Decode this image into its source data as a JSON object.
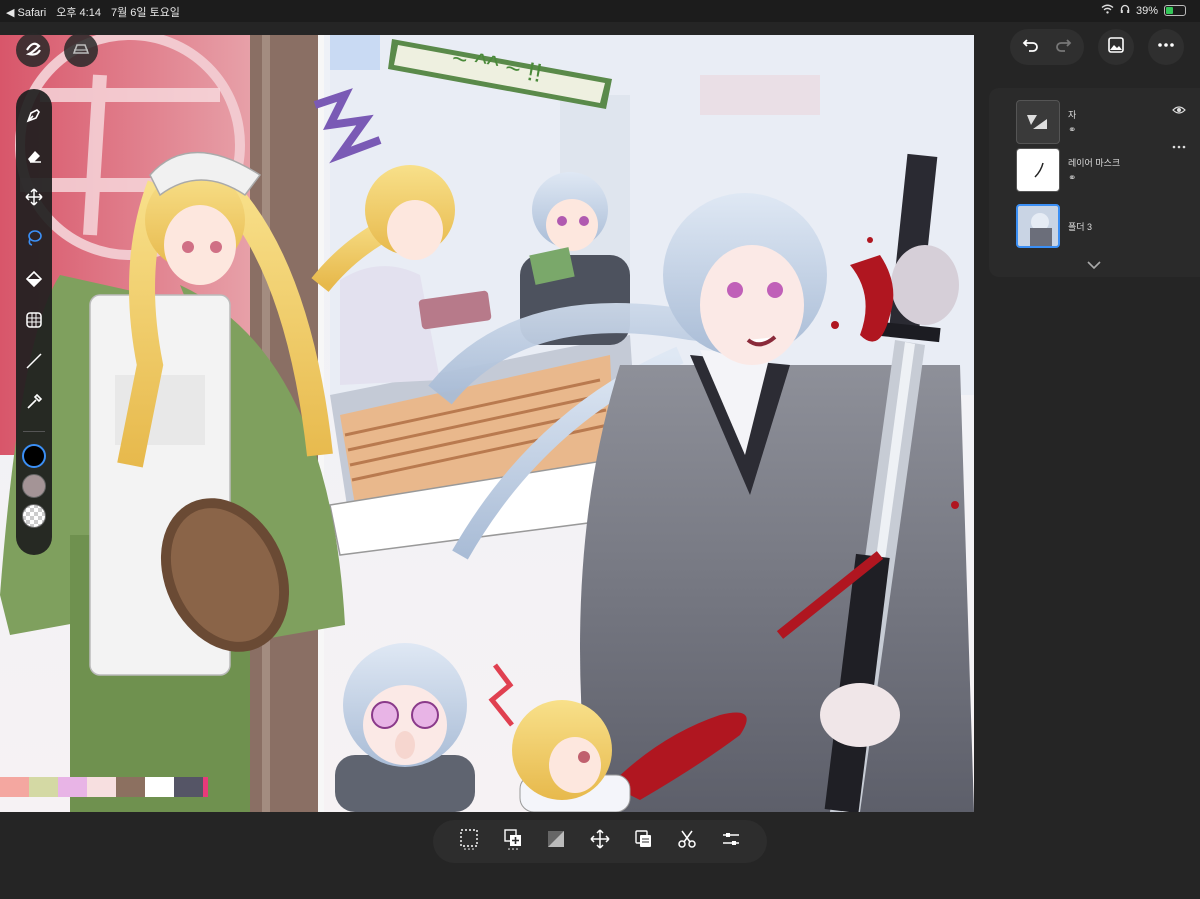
{
  "status_bar": {
    "back_label": "◀ Safari",
    "time": "오후 4:14",
    "date": "7월 6일 토요일",
    "battery": "39%",
    "battery_level": 0.39
  },
  "canvas": {
    "sign_text": "~ ^^ ~ !!"
  },
  "palette": [
    "#f4a7a0",
    "#d4d9a4",
    "#e8b4e6",
    "#f7dfe0",
    "#8c7060",
    "#ffffff",
    "#555566",
    "#e83a7a"
  ],
  "colors": {
    "primary": "#000000",
    "secondary": "#a49496",
    "tertiary": "transparent",
    "accent": "#3b8ff5"
  },
  "toolbar": {
    "tools": [
      {
        "name": "pen-icon"
      },
      {
        "name": "eraser-icon"
      },
      {
        "name": "move-icon"
      },
      {
        "name": "lasso-icon",
        "active": true
      },
      {
        "name": "fill-icon"
      },
      {
        "name": "grid-icon"
      },
      {
        "name": "line-icon"
      },
      {
        "name": "eyedropper-icon"
      }
    ]
  },
  "layers": {
    "items": [
      {
        "name": "자",
        "kind": "adjustment"
      },
      {
        "name": "레이어 마스크",
        "kind": "mask"
      },
      {
        "name": "폴더 3",
        "kind": "folder",
        "selected": true
      }
    ]
  },
  "bottom_toolbar": {
    "tools": [
      "select-icon",
      "add-layer-icon",
      "gradient-icon",
      "transform-icon",
      "duplicate-icon",
      "cut-icon",
      "adjust-icon"
    ]
  }
}
